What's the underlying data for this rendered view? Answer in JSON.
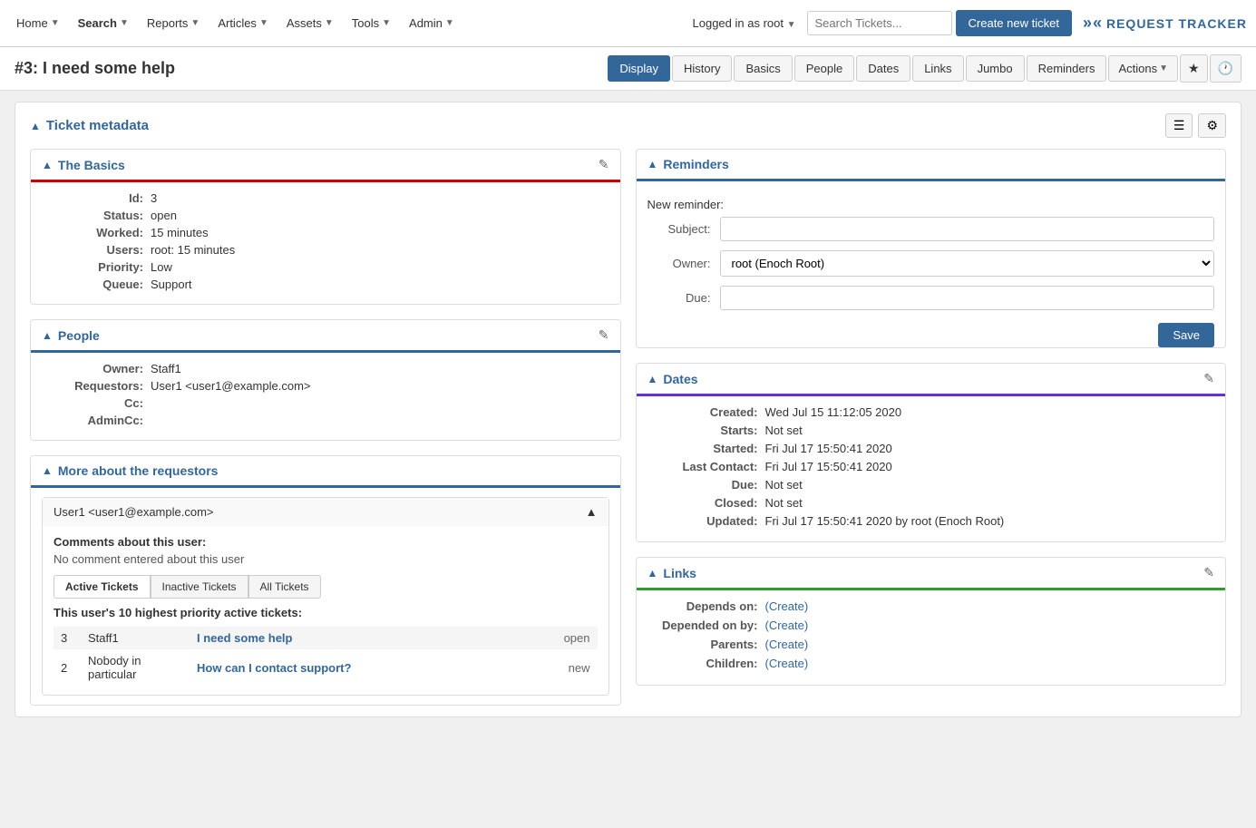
{
  "nav": {
    "items": [
      {
        "label": "Home",
        "hasDropdown": true
      },
      {
        "label": "Search",
        "hasDropdown": true,
        "bold": true
      },
      {
        "label": "Reports",
        "hasDropdown": true
      },
      {
        "label": "Articles",
        "hasDropdown": true
      },
      {
        "label": "Assets",
        "hasDropdown": true
      },
      {
        "label": "Tools",
        "hasDropdown": true
      },
      {
        "label": "Admin",
        "hasDropdown": true
      }
    ],
    "logged_in": "Logged in as root",
    "search_placeholder": "Search Tickets...",
    "create_btn": "Create new ticket",
    "logo": "REQUEST TRACKER"
  },
  "ticket": {
    "title": "#3: I need some help",
    "tabs": [
      {
        "label": "Display",
        "active": true
      },
      {
        "label": "History"
      },
      {
        "label": "Basics"
      },
      {
        "label": "People"
      },
      {
        "label": "Dates"
      },
      {
        "label": "Links"
      },
      {
        "label": "Jumbo"
      },
      {
        "label": "Reminders"
      },
      {
        "label": "Actions",
        "hasDropdown": true
      }
    ]
  },
  "metadata": {
    "title": "Ticket metadata",
    "icons": [
      "list-icon",
      "gear-icon"
    ]
  },
  "basics": {
    "title": "The Basics",
    "fields": [
      {
        "label": "Id:",
        "value": "3"
      },
      {
        "label": "Status:",
        "value": "open"
      },
      {
        "label": "Worked:",
        "value": "15 minutes"
      },
      {
        "label": "Users:",
        "value": "root: 15 minutes"
      },
      {
        "label": "Priority:",
        "value": "Low"
      },
      {
        "label": "Queue:",
        "value": "Support"
      }
    ]
  },
  "people": {
    "title": "People",
    "fields": [
      {
        "label": "Owner:",
        "value": "Staff1"
      },
      {
        "label": "Requestors:",
        "value": "User1 <user1@example.com>"
      },
      {
        "label": "Cc:",
        "value": ""
      },
      {
        "label": "AdminCc:",
        "value": ""
      }
    ]
  },
  "more_about": {
    "title": "More about the requestors",
    "user": "User1 <user1@example.com>",
    "comments_header": "Comments about this user:",
    "comments_text": "No comment entered about this user",
    "tabs": [
      "Active Tickets",
      "Inactive Tickets",
      "All Tickets"
    ],
    "active_tab": "Active Tickets",
    "priority_text": "This user's 10 highest priority active tickets:",
    "tickets": [
      {
        "id": "3",
        "owner": "Staff1",
        "subject": "I need some help",
        "status": "open"
      },
      {
        "id": "2",
        "owner": "Nobody in particular",
        "subject": "How can I contact support?",
        "status": "new"
      }
    ]
  },
  "reminders": {
    "title": "Reminders",
    "new_reminder_label": "New reminder:",
    "subject_label": "Subject:",
    "owner_label": "Owner:",
    "owner_value": "root (Enoch Root)",
    "due_label": "Due:",
    "save_btn": "Save"
  },
  "dates": {
    "title": "Dates",
    "fields": [
      {
        "label": "Created:",
        "value": "Wed Jul 15 11:12:05 2020"
      },
      {
        "label": "Starts:",
        "value": "Not set"
      },
      {
        "label": "Started:",
        "value": "Fri Jul 17 15:50:41 2020"
      },
      {
        "label": "Last Contact:",
        "value": "Fri Jul 17 15:50:41 2020"
      },
      {
        "label": "Due:",
        "value": "Not set"
      },
      {
        "label": "Closed:",
        "value": "Not set"
      },
      {
        "label": "Updated:",
        "value": "Fri Jul 17 15:50:41 2020 by root (Enoch Root)"
      }
    ]
  },
  "links": {
    "title": "Links",
    "fields": [
      {
        "label": "Depends on:",
        "value": "(Create)"
      },
      {
        "label": "Depended on by:",
        "value": "(Create)"
      },
      {
        "label": "Parents:",
        "value": "(Create)"
      },
      {
        "label": "Children:",
        "value": "(Create)"
      }
    ]
  }
}
